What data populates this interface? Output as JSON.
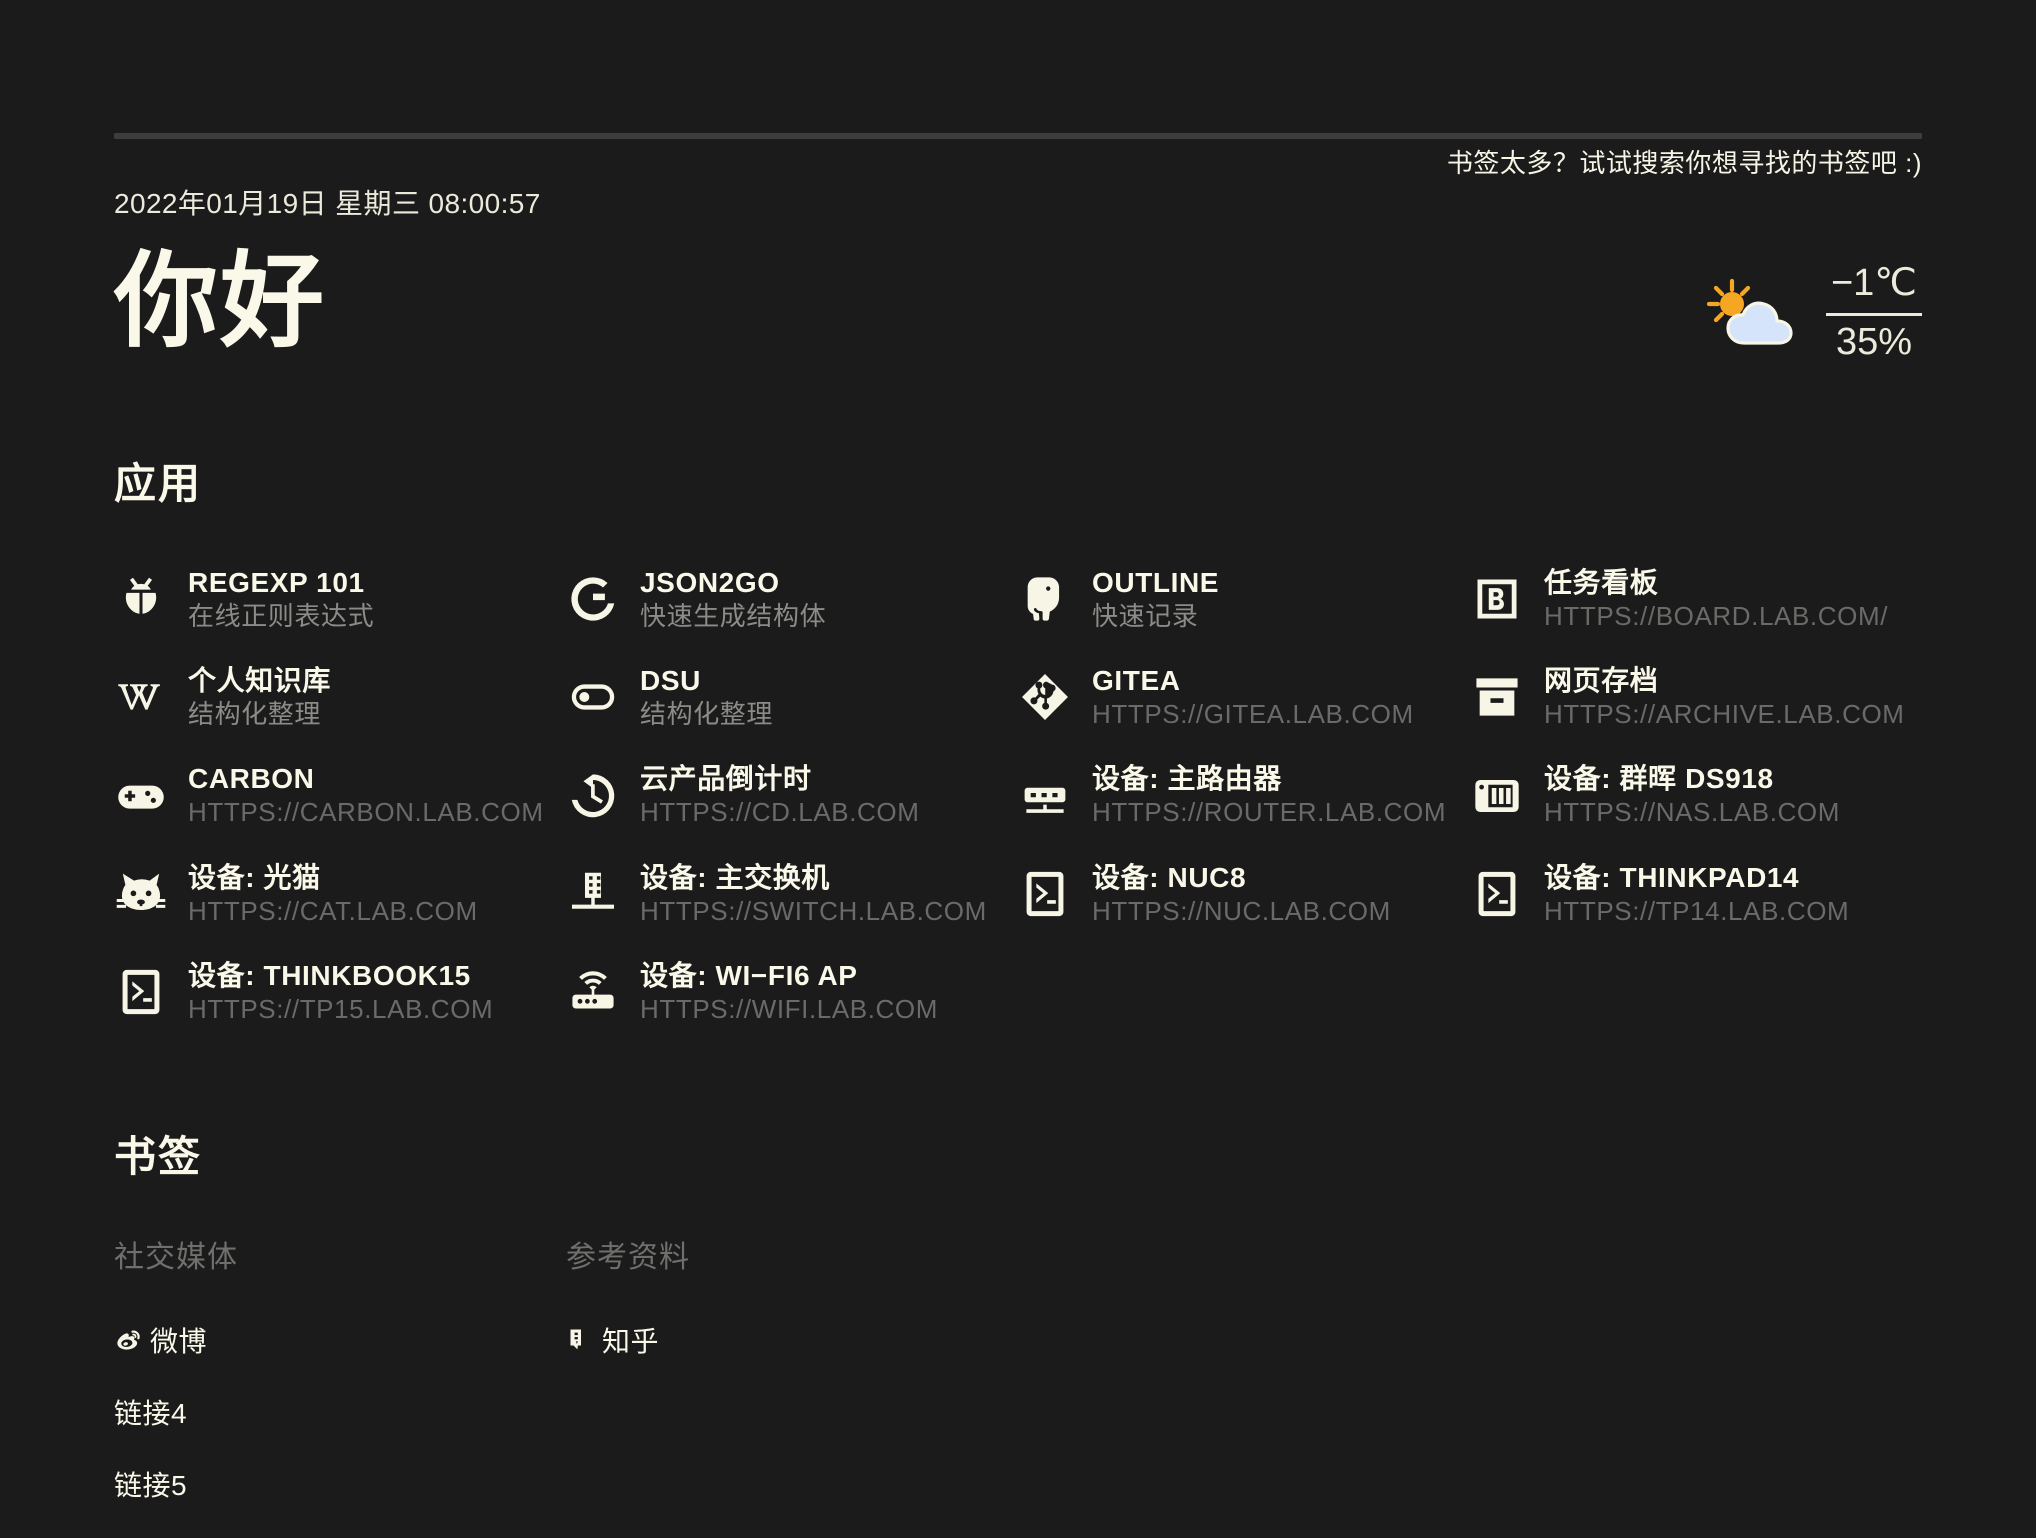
{
  "header": {
    "search_hint": "书签太多？试试搜索你想寻找的书签吧 :)",
    "datetime": "2022年01月19日 星期三 08:00:57",
    "greeting": "你好"
  },
  "weather": {
    "icon": "sun-behind-cloud-icon",
    "temperature": "−1℃",
    "humidity": "35%",
    "sun_color": "#f5a623",
    "cloud_color": "#d5e4fa"
  },
  "apps": {
    "title": "应用",
    "items": [
      {
        "icon": "bug-icon",
        "name": "REGEXP 101",
        "sub": "在线正则表达式",
        "sub_type": "cn"
      },
      {
        "icon": "google-g-icon",
        "name": "JSON2GO",
        "sub": "快速生成结构体",
        "sub_type": "cn"
      },
      {
        "icon": "elephant-icon",
        "name": "OUTLINE",
        "sub": "快速记录",
        "sub_type": "cn"
      },
      {
        "icon": "board-b-icon",
        "name": "任务看板",
        "sub": "HTTPS://BOARD.LAB.COM/",
        "sub_type": "url"
      },
      {
        "icon": "wikipedia-w-icon",
        "name": "个人知识库",
        "sub": "结构化整理",
        "sub_type": "cn"
      },
      {
        "icon": "toggle-icon",
        "name": "DSU",
        "sub": "结构化整理",
        "sub_type": "cn"
      },
      {
        "icon": "gitea-icon",
        "name": "GITEA",
        "sub": "HTTPS://GITEA.LAB.COM",
        "sub_type": "url"
      },
      {
        "icon": "archive-box-icon",
        "name": "网页存档",
        "sub": "HTTPS://ARCHIVE.LAB.COM",
        "sub_type": "url"
      },
      {
        "icon": "gamepad-icon",
        "name": "CARBON",
        "sub": "HTTPS://CARBON.LAB.COM",
        "sub_type": "url"
      },
      {
        "icon": "clock-arrow-icon",
        "name": "云产品倒计时",
        "sub": "HTTPS://CD.LAB.COM",
        "sub_type": "url"
      },
      {
        "icon": "router-icon",
        "name": "设备: 主路由器",
        "sub": "HTTPS://ROUTER.LAB.COM",
        "sub_type": "url"
      },
      {
        "icon": "nas-icon",
        "name": "设备: 群晖 DS918",
        "sub": "HTTPS://NAS.LAB.COM",
        "sub_type": "url"
      },
      {
        "icon": "cat-icon",
        "name": "设备: 光猫",
        "sub": "HTTPS://CAT.LAB.COM",
        "sub_type": "url"
      },
      {
        "icon": "switch-icon",
        "name": "设备: 主交换机",
        "sub": "HTTPS://SWITCH.LAB.COM",
        "sub_type": "url"
      },
      {
        "icon": "terminal-icon",
        "name": "设备: NUC8",
        "sub": "HTTPS://NUC.LAB.COM",
        "sub_type": "url"
      },
      {
        "icon": "terminal-icon",
        "name": "设备: THINKPAD14",
        "sub": "HTTPS://TP14.LAB.COM",
        "sub_type": "url"
      },
      {
        "icon": "terminal-icon",
        "name": "设备: THINKBOOK15",
        "sub": "HTTPS://TP15.LAB.COM",
        "sub_type": "url"
      },
      {
        "icon": "wifi-ap-icon",
        "name": "设备: WI−FI6 AP",
        "sub": "HTTPS://WIFI.LAB.COM",
        "sub_type": "url"
      }
    ]
  },
  "bookmarks": {
    "title": "书签",
    "groups": [
      {
        "title": "社交媒体",
        "links": [
          {
            "icon": "weibo-icon",
            "label": "微博"
          },
          {
            "icon": "",
            "label": "链接4"
          },
          {
            "icon": "",
            "label": "链接5"
          }
        ]
      },
      {
        "title": "参考资料",
        "links": [
          {
            "icon": "zhihu-icon",
            "label": "知乎"
          }
        ]
      }
    ]
  },
  "colors": {
    "background": "#1b1b1b",
    "foreground": "#faf8e9",
    "muted": "#6a6a68",
    "rule": "#3d3d3d"
  }
}
